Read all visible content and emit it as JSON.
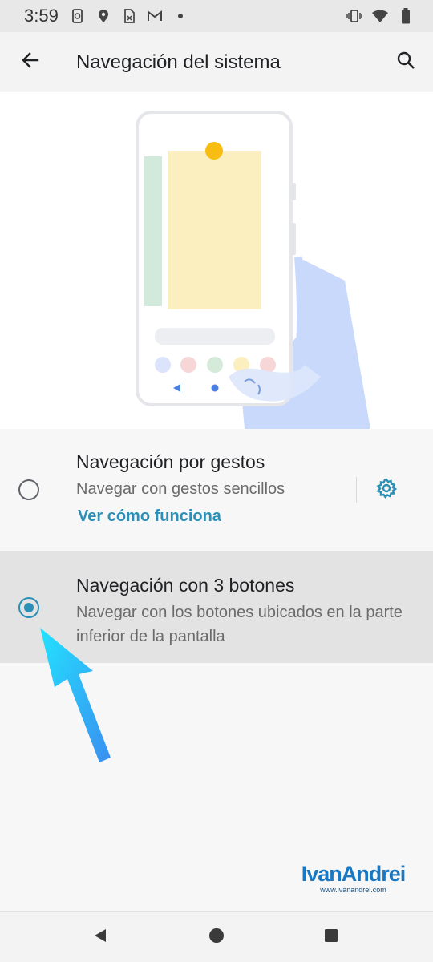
{
  "status_bar": {
    "time": "3:59",
    "left_icons": [
      "phone-sync-icon",
      "location-icon",
      "sim-icon",
      "gmail-icon",
      "dot-icon"
    ],
    "right_icons": [
      "vibrate-icon",
      "wifi-icon",
      "battery-icon"
    ]
  },
  "app_bar": {
    "title": "Navegación del sistema",
    "back_icon": "arrow-back-icon",
    "search_icon": "search-icon"
  },
  "options": {
    "gestures": {
      "title": "Navegación por gestos",
      "summary": "Navegar con gestos sencillos",
      "link": "Ver cómo funciona",
      "selected": false,
      "settings_icon": "gear-icon"
    },
    "buttons": {
      "title": "Navegación con 3 botones",
      "summary": "Navegar con los botones ubicados en la parte inferior de la pantalla",
      "selected": true
    }
  },
  "watermark": {
    "name": "IvanAndrei",
    "url": "www.ivanandrei.com"
  },
  "nav_bar": {
    "icons": [
      "nav-back-icon",
      "nav-home-icon",
      "nav-recents-icon"
    ]
  },
  "colors": {
    "accent": "#2b8fb6",
    "selected_row": "#e3e3e3",
    "arrow": "#29c6f0",
    "watermark": "#1a78c2"
  }
}
